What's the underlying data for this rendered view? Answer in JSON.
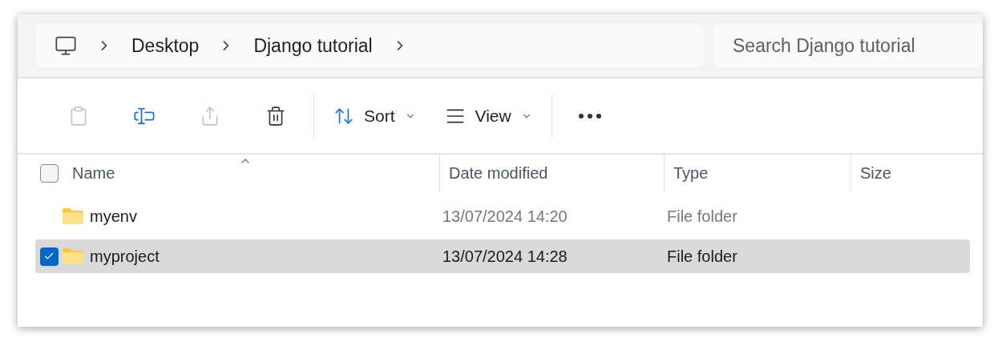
{
  "breadcrumb": [
    {
      "label": "Desktop"
    },
    {
      "label": "Django tutorial"
    }
  ],
  "search": {
    "placeholder": "Search Django tutorial"
  },
  "toolbar": [
    {
      "kind": "paste",
      "disabled": true
    },
    {
      "kind": "rename",
      "disabled": false
    },
    {
      "kind": "share",
      "disabled": true
    },
    {
      "kind": "delete",
      "disabled": false
    },
    {
      "kind": "sort",
      "label": "Sort",
      "disabled": false
    },
    {
      "kind": "view",
      "label": "View",
      "disabled": false
    },
    {
      "kind": "more",
      "disabled": false
    }
  ],
  "table": {
    "select_all": {
      "checked": false
    },
    "columns": [
      "Name",
      "Date modified",
      "Type",
      "Size"
    ],
    "rows": [
      {
        "name": "myenv",
        "date": "13/07/2024 14:20",
        "type": "File folder",
        "selected": false
      },
      {
        "name": "myproject",
        "date": "13/07/2024 14:28",
        "type": "File folder",
        "selected": true
      }
    ]
  }
}
